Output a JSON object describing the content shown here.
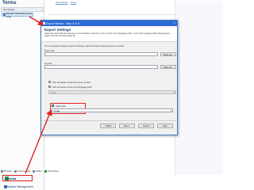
{
  "nav": {
    "title": "Terms",
    "pane_header": "Termbases",
    "tree_item": "Sample Termbase (read-only)",
    "tabs": [
      "Browse",
      "Source-lang",
      "Hitlist",
      "Termbases"
    ],
    "termbases_button": "Termba",
    "management_button": "Termbase Management"
  },
  "background": {
    "tabs": [
      "Terms/Defn",
      "Entry"
    ]
  },
  "dialog": {
    "title": "Export Wizard - Step 3 of 5",
    "close_glyph": "×",
    "heading": "Export Settings",
    "description": "Select the export file and choose to sort termbase content by entry number or by language index. If you wish to apply a filter during export, select one from the drop-down list.",
    "note": "For a complete backup of your termbase, Sort termbase content by entry number.",
    "export_file_label": "Export file:",
    "export_file_value": "",
    "save_as_label": "Save As...",
    "log_file_label": "Log file:",
    "log_file_value": "",
    "log_save_as_label": "Save As...",
    "sort_entry_label": "Sort termbase content by entry number",
    "sort_language_label": "Sort termbase content by language field",
    "language_field_value": "Notes",
    "apply_filter_label": "Apply filter",
    "apply_filter_checked": "✓",
    "filter_value": "Today",
    "footer": {
      "back": "< Back",
      "next": "Next >",
      "cancel": "Cancel",
      "help": "Help"
    }
  },
  "colors": {
    "accent": "#2c6ad6",
    "highlight": "#e02020",
    "navy": "#1b3d66"
  }
}
